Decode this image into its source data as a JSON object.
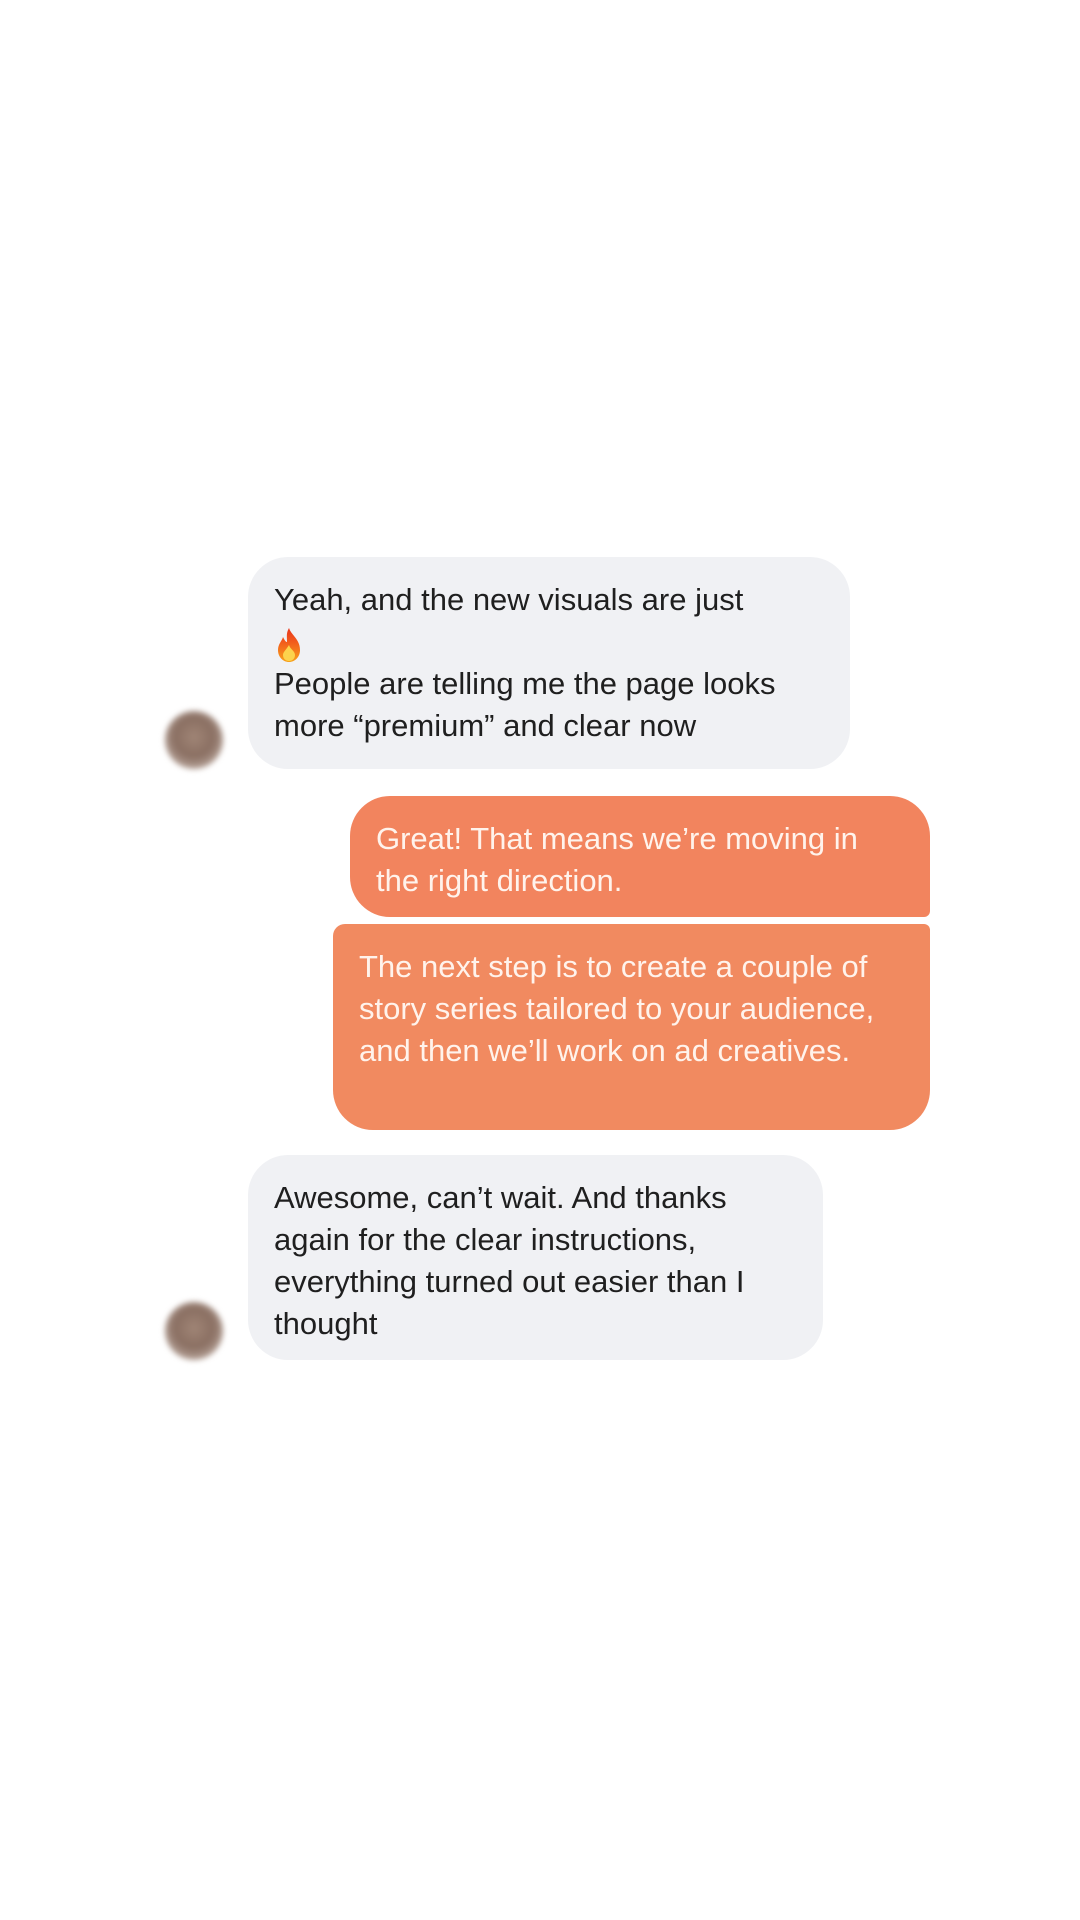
{
  "conversation": {
    "messages": [
      {
        "sender": "contact",
        "line1": "Yeah, and the new visuals are just",
        "emoji": "fire-emoji",
        "line2": "People are telling me the page looks more “premium” and clear now"
      },
      {
        "sender": "me",
        "text": "Great! That means we’re moving in the right direction."
      },
      {
        "sender": "me",
        "text": "The next step is to create a couple of story series tailored to your audience, and then we’ll work on ad creatives."
      },
      {
        "sender": "contact",
        "text": "Awesome, can’t wait. And thanks again for the clear instructions, everything turned out easier than I thought"
      }
    ]
  },
  "colors": {
    "incoming_bubble": "#f0f1f4",
    "outgoing_bubble": "#f2845e",
    "incoming_text": "#1f1f1f",
    "outgoing_text": "#fff3ec"
  }
}
